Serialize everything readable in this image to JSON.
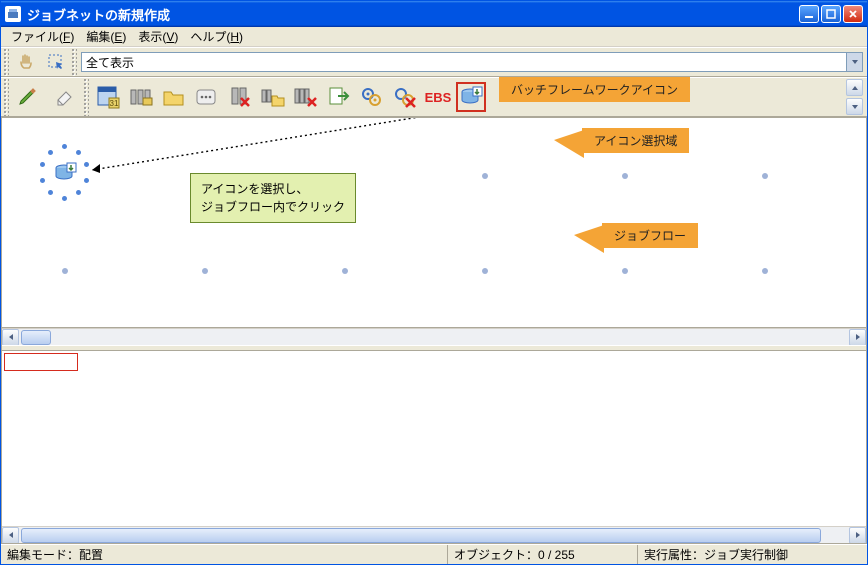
{
  "window": {
    "title": "ジョブネットの新規作成"
  },
  "menu": {
    "file": "ファイル(",
    "file_u": "F",
    "file_end": ")",
    "edit": "編集(",
    "edit_u": "E",
    "edit_end": ")",
    "view": "表示(",
    "view_u": "V",
    "view_end": ")",
    "help": "ヘルプ(",
    "help_u": "H",
    "help_end": ")"
  },
  "filter": {
    "selected": "全て表示"
  },
  "palette": {
    "items": [
      {
        "name": "calendar-icon"
      },
      {
        "name": "server-group-icon"
      },
      {
        "name": "folder-icon"
      },
      {
        "name": "dialog-icon"
      },
      {
        "name": "server-cancel-icon"
      },
      {
        "name": "server-folder-icon"
      },
      {
        "name": "servers-cancel-icon"
      },
      {
        "name": "export-icon"
      },
      {
        "name": "gears-icon"
      },
      {
        "name": "gears-cancel-icon"
      },
      {
        "name": "ebs-icon",
        "text": "EBS"
      },
      {
        "name": "batch-framework-icon"
      }
    ]
  },
  "callouts": {
    "batch_framework": "バッチフレームワークアイコン",
    "icon_select_area": "アイコン選択域",
    "job_flow": "ジョブフロー"
  },
  "tooltip": {
    "line1": "アイコンを選択し、",
    "line2": "ジョブフロー内でクリック"
  },
  "status": {
    "mode": "編集モード：配置",
    "object": "オブジェクト：0 / 255",
    "attr": "実行属性：ジョブ実行制御"
  }
}
